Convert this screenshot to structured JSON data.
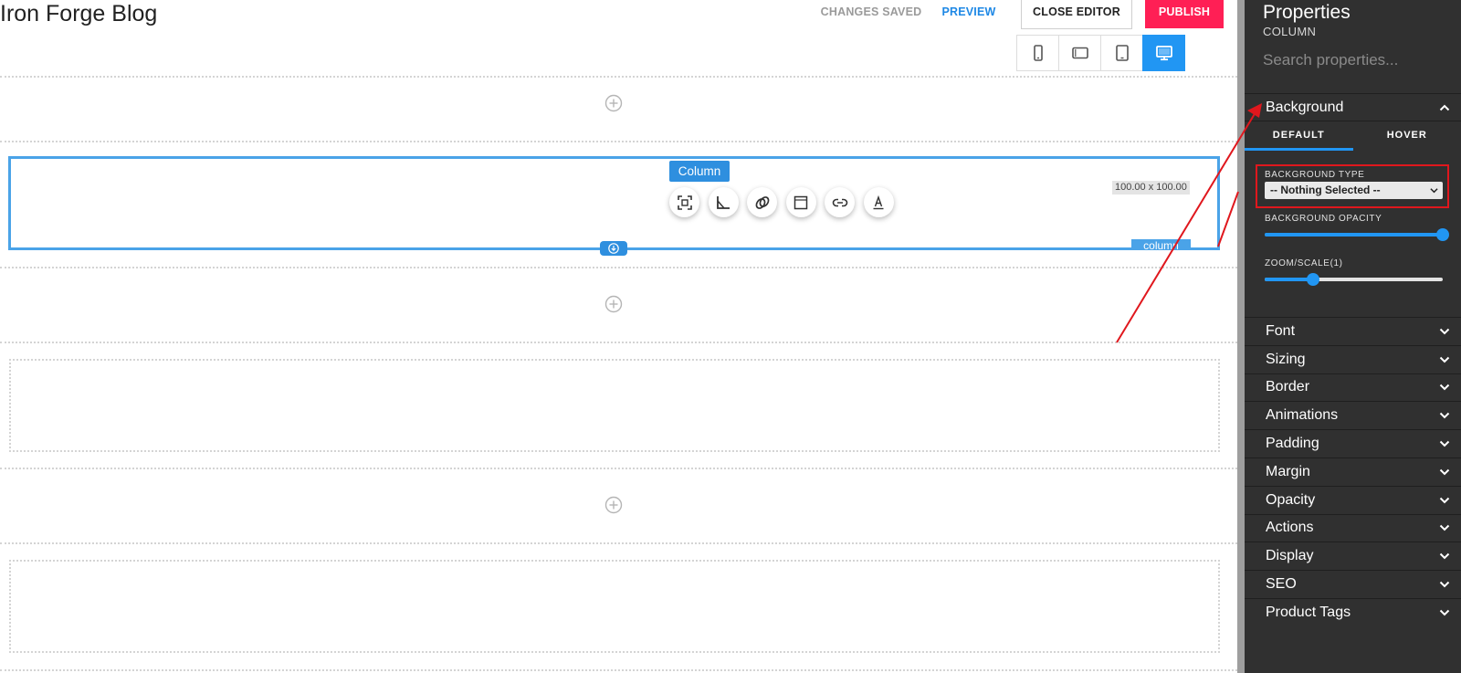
{
  "header": {
    "site_title": "Iron Forge Blog",
    "status": "CHANGES SAVED",
    "preview_label": "PREVIEW",
    "close_editor_label": "CLOSE EDITOR",
    "publish_label": "PUBLISH",
    "devices": [
      {
        "name": "mobile",
        "icon": "phone-icon",
        "active": false
      },
      {
        "name": "tablet-landscape",
        "icon": "tablet-landscape-icon",
        "active": false
      },
      {
        "name": "tablet",
        "icon": "tablet-icon",
        "active": false
      },
      {
        "name": "desktop",
        "icon": "desktop-icon",
        "active": true
      }
    ]
  },
  "canvas": {
    "selected_element_label": "Column",
    "selected_dimensions": "100.00 x 100.00",
    "bottom_tag": "column",
    "toolbar_icons": [
      "select-icon",
      "measure-icon",
      "link-chain-icon",
      "frame-icon",
      "link-icon",
      "text-color-icon"
    ]
  },
  "panel": {
    "title": "Properties",
    "subtitle": "COLUMN",
    "search_placeholder": "Search properties...",
    "background": {
      "title": "Background",
      "tabs": [
        "DEFAULT",
        "HOVER"
      ],
      "active_tab": "DEFAULT",
      "type_label": "BACKGROUND TYPE",
      "type_value": "-- Nothing Selected --",
      "opacity_label": "BACKGROUND OPACITY",
      "opacity_value": 1.0,
      "zoom_label": "ZOOM/SCALE(1)",
      "zoom_value": 0.27
    },
    "sections": [
      "Font",
      "Sizing",
      "Border",
      "Animations",
      "Padding",
      "Margin",
      "Opacity",
      "Actions",
      "Display",
      "SEO",
      "Product Tags"
    ]
  },
  "colors": {
    "accent": "#2196f3",
    "publish": "#ff1f55",
    "panel_bg": "#303030",
    "highlight_box": "#e0171d",
    "annotation_arrow": "#e0171d"
  }
}
